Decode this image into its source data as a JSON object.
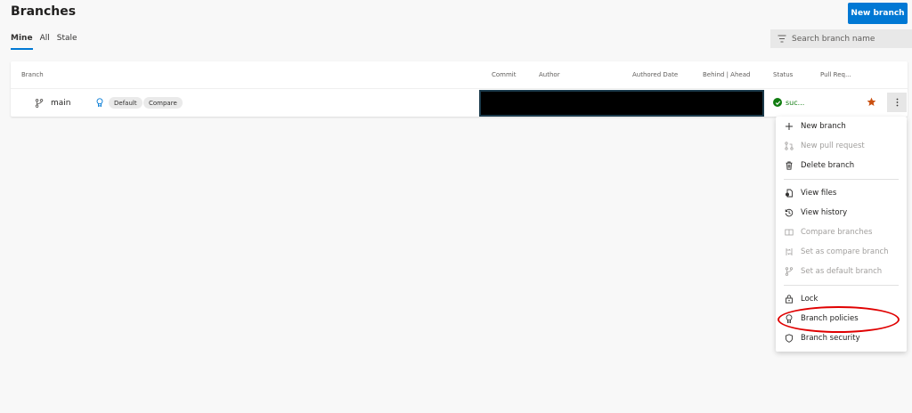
{
  "header": {
    "title": "Branches",
    "new_branch_label": "New branch"
  },
  "tabs": [
    {
      "label": "Mine",
      "active": true
    },
    {
      "label": "All",
      "active": false
    },
    {
      "label": "Stale",
      "active": false
    }
  ],
  "search": {
    "placeholder": "Search branch name",
    "icon": "filter-icon"
  },
  "table": {
    "columns": {
      "branch": "Branch",
      "commit": "Commit",
      "author": "Author",
      "authored_date": "Authored Date",
      "behind_ahead": "Behind | Ahead",
      "status": "Status",
      "pull_request": "Pull Req..."
    },
    "rows": [
      {
        "name": "main",
        "tags": [
          "Default",
          "Compare"
        ],
        "status_text": "suc...",
        "status_color": "#107c10",
        "favorite": true
      }
    ]
  },
  "menu": {
    "items": [
      {
        "label": "New branch",
        "icon": "plus-icon",
        "disabled": false
      },
      {
        "label": "New pull request",
        "icon": "pull-request-icon",
        "disabled": true
      },
      {
        "label": "Delete branch",
        "icon": "trash-icon",
        "disabled": false
      },
      {
        "label": "View files",
        "icon": "files-icon",
        "disabled": false
      },
      {
        "label": "View history",
        "icon": "history-icon",
        "disabled": false
      },
      {
        "label": "Compare branches",
        "icon": "compare-icon",
        "disabled": true
      },
      {
        "label": "Set as compare branch",
        "icon": "set-compare-icon",
        "disabled": true
      },
      {
        "label": "Set as default branch",
        "icon": "branch-icon",
        "disabled": true
      },
      {
        "label": "Lock",
        "icon": "lock-icon",
        "disabled": false
      },
      {
        "label": "Branch policies",
        "icon": "policy-icon",
        "disabled": false
      },
      {
        "label": "Branch security",
        "icon": "shield-icon",
        "disabled": false
      }
    ]
  },
  "colors": {
    "accent": "#0078d4",
    "success": "#107c10",
    "favorite": "#ca5010",
    "annotation": "#e00000"
  }
}
